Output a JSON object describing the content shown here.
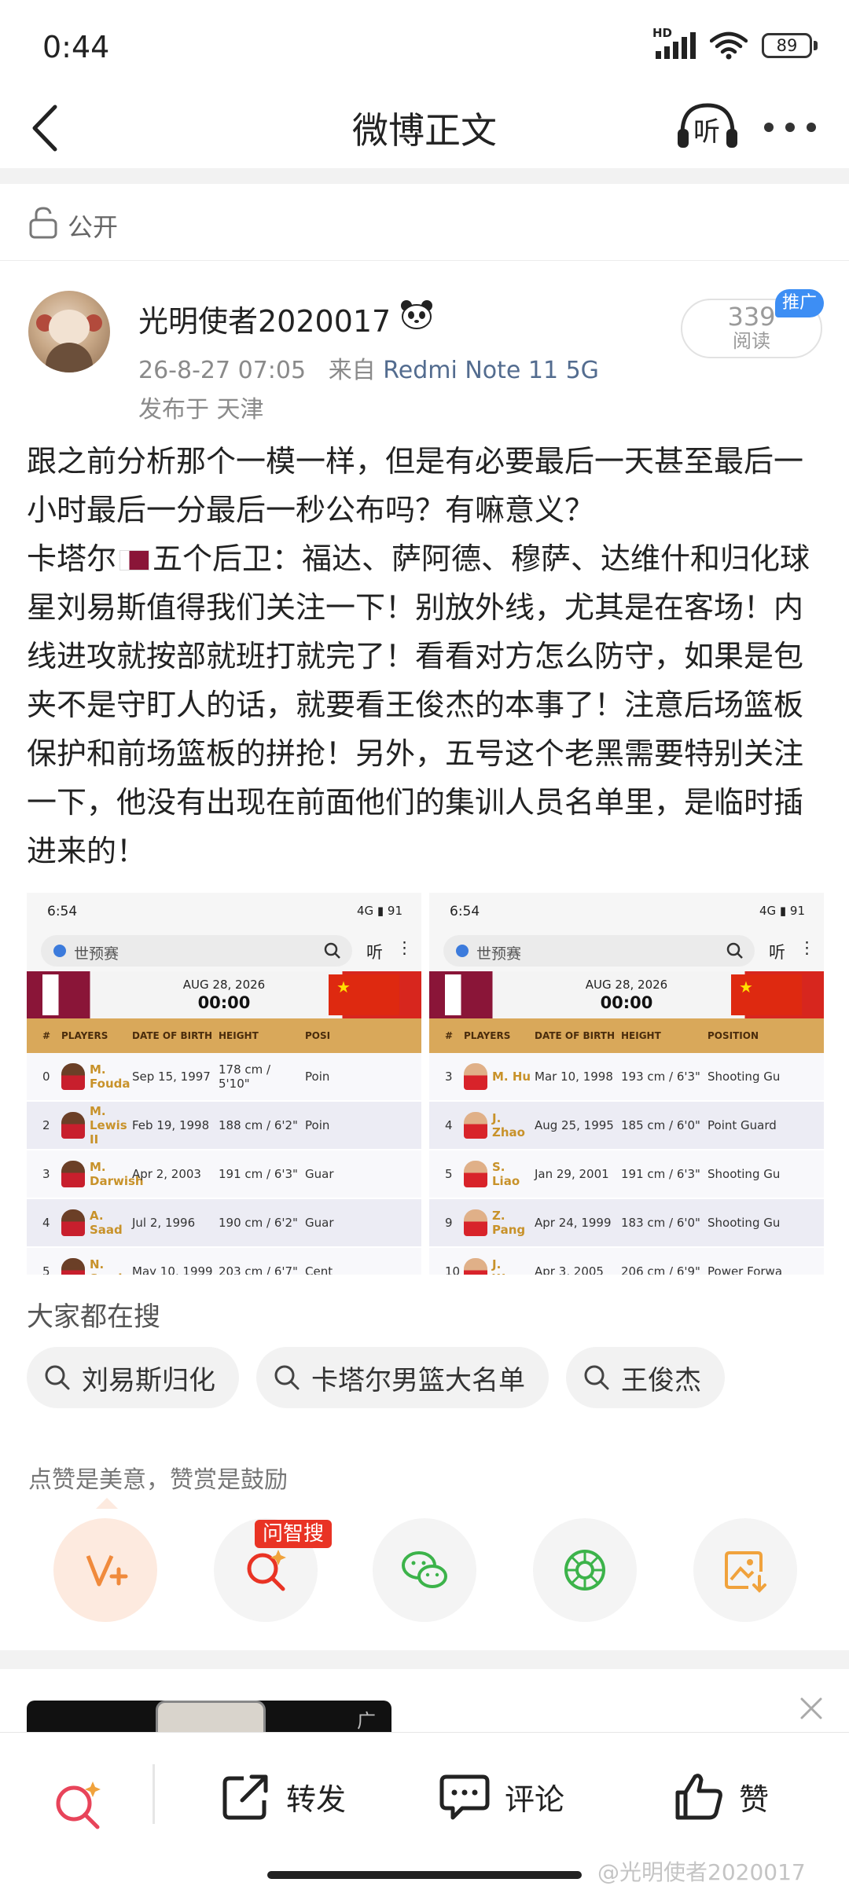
{
  "status_bar": {
    "time": "0:44",
    "network": "HD",
    "battery": "89"
  },
  "nav": {
    "title": "微博正文",
    "back_icon": "chevron-left-icon",
    "listen_icon": "headphone-listen-icon",
    "listen_label": "听",
    "more_icon": "more-dots-icon"
  },
  "visibility": {
    "label": "公开",
    "icon": "lock-open-icon"
  },
  "author": {
    "name": "光明使者2020017",
    "badge_icon": "panda-icon",
    "time": "26-8-27 07:05",
    "source_prefix": "来自",
    "source_device": "Redmi Note 11 5G",
    "location": "发布于 天津"
  },
  "reads": {
    "count": "339",
    "label": "阅读",
    "promo_badge": "推广"
  },
  "post": {
    "text_before_flag": "跟之前分析那个一模一样，但是有必要最后一天甚至最后一小时最后一分最后一秒公布吗？有嘛意义？\n卡塔尔",
    "text_after_flag": "五个后卫：福达、萨阿德、穆萨、达维什和归化球星刘易斯值得我们关注一下！别放外线，尤其是在客场！内线进攻就按部就班打就完了！看看对方怎么防守，如果是包夹不是守盯人的话，就要看王俊杰的本事了！注意后场篮板保护和前场篮板的拼抢！另外，五号这个老黑需要特别关注一下，他没有出现在前面他们的集训人员名单里，是临时插进来的！"
  },
  "images": [
    {
      "status_time": "6:54",
      "status_right": "4G ▮ 91",
      "search_query": "世预赛",
      "listen": "听",
      "more": "⋮",
      "match_date": "AUG 28, 2026",
      "match_time": "00:00",
      "headers": [
        "#",
        "PLAYERS",
        "DATE OF BIRTH",
        "HEIGHT",
        "POSI"
      ],
      "rows": [
        {
          "num": "0",
          "name": "M. Fouda",
          "dob": "Sep 15, 1997",
          "height": "178 cm / 5'10\"",
          "pos": "Poin"
        },
        {
          "num": "2",
          "name": "M. Lewis II",
          "dob": "Feb 19, 1998",
          "height": "188 cm / 6'2\"",
          "pos": "Poin"
        },
        {
          "num": "3",
          "name": "M. Darwish",
          "dob": "Apr 2, 2003",
          "height": "191 cm / 6'3\"",
          "pos": "Guar"
        },
        {
          "num": "4",
          "name": "A. Saad",
          "dob": "Jul 2, 1996",
          "height": "190 cm / 6'2\"",
          "pos": "Guar"
        },
        {
          "num": "5",
          "name": "N. Seydou",
          "dob": "May 10, 1999",
          "height": "203 cm / 6'7\"",
          "pos": "Cent"
        }
      ]
    },
    {
      "status_time": "6:54",
      "status_right": "4G ▮ 91",
      "search_query": "世预赛",
      "listen": "听",
      "more": "⋮",
      "match_date": "AUG 28, 2026",
      "match_time": "00:00",
      "headers": [
        "#",
        "PLAYERS",
        "DATE OF BIRTH",
        "HEIGHT",
        "POSITION"
      ],
      "rows": [
        {
          "num": "3",
          "name": "M. Hu",
          "dob": "Mar 10, 1998",
          "height": "193 cm / 6'3\"",
          "pos": "Shooting Gu"
        },
        {
          "num": "4",
          "name": "J. Zhao",
          "dob": "Aug 25, 1995",
          "height": "185 cm / 6'0\"",
          "pos": "Point Guard"
        },
        {
          "num": "5",
          "name": "S. Liao",
          "dob": "Jan 29, 2001",
          "height": "191 cm / 6'3\"",
          "pos": "Shooting Gu"
        },
        {
          "num": "9",
          "name": "Z. Pang",
          "dob": "Apr 24, 1999",
          "height": "183 cm / 6'0\"",
          "pos": "Shooting Gu"
        },
        {
          "num": "10",
          "name": "J. Wang",
          "dob": "Apr 3, 2005",
          "height": "206 cm / 6'9\"",
          "pos": "Power Forwa"
        }
      ]
    }
  ],
  "searches": {
    "label": "大家都在搜",
    "items": [
      "刘易斯归化",
      "卡塔尔男篮大名单",
      "王俊杰"
    ]
  },
  "tip": "点赞是美意，赞赏是鼓励",
  "actions": {
    "zhisou_badge": "问智搜",
    "items": [
      "reward-v-plus-icon",
      "zhisou-search-icon",
      "wechat-icon",
      "moments-icon",
      "save-image-icon"
    ]
  },
  "ad": {
    "label": "广告"
  },
  "bottom_bar": {
    "repost": "转发",
    "comment": "评论",
    "like": "赞",
    "watermark": "@光明使者2020017"
  },
  "colors": {
    "accent_orange": "#f08a3c",
    "link_blue": "#536c8f",
    "promo_blue": "#3d8ef4",
    "badge_red": "#e93324",
    "wechat_green": "#3cb34a"
  }
}
